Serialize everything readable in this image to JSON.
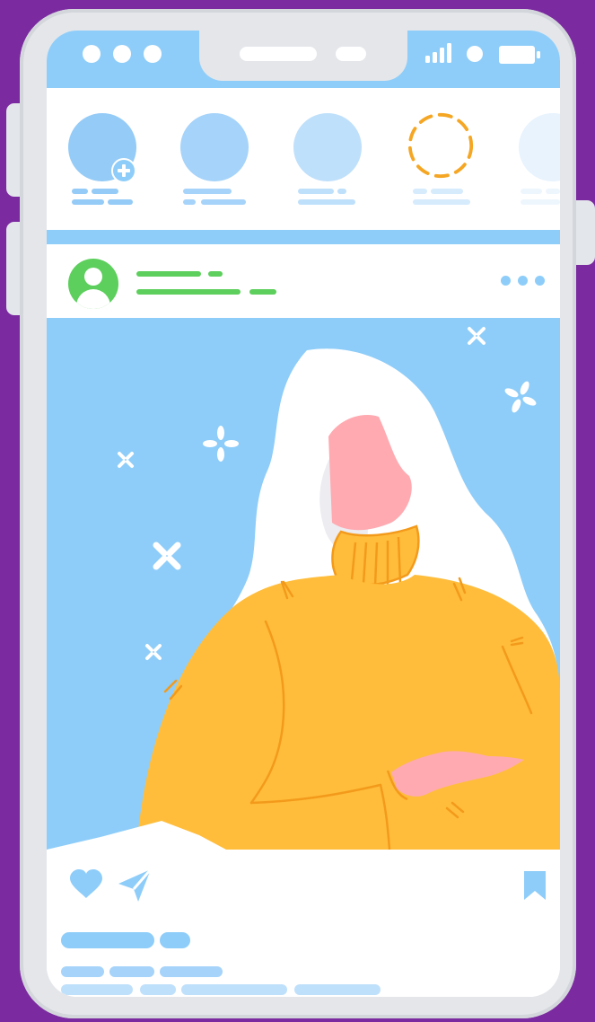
{
  "theme": {
    "background": "#7b2aa0",
    "phone_frame": "#e4e6ea",
    "accent_blue": "#8ecdf9",
    "light_blue": "#bfe0fb",
    "green": "#5ccf5c",
    "orange": "#f5a623",
    "sweater": "#ffbd3b",
    "skin": "#ffaab1"
  },
  "status_bar": {
    "icons": [
      "dot-icon",
      "dot-icon",
      "dot-icon",
      "signal-icon",
      "dot-icon",
      "battery-icon"
    ]
  },
  "stories": [
    {
      "icon": "add-story-icon",
      "state": "own"
    },
    {
      "icon": "story-avatar",
      "state": "seen"
    },
    {
      "icon": "story-avatar",
      "state": "seen"
    },
    {
      "icon": "story-avatar",
      "state": "unseen-dashed"
    },
    {
      "icon": "story-avatar",
      "state": "faded"
    }
  ],
  "post": {
    "header_icons": [
      "user-avatar-icon",
      "more-options-icon"
    ],
    "image": "illustration-woman-yellow-sweater",
    "action_icons": [
      "heart-icon",
      "send-icon",
      "bookmark-icon"
    ]
  }
}
